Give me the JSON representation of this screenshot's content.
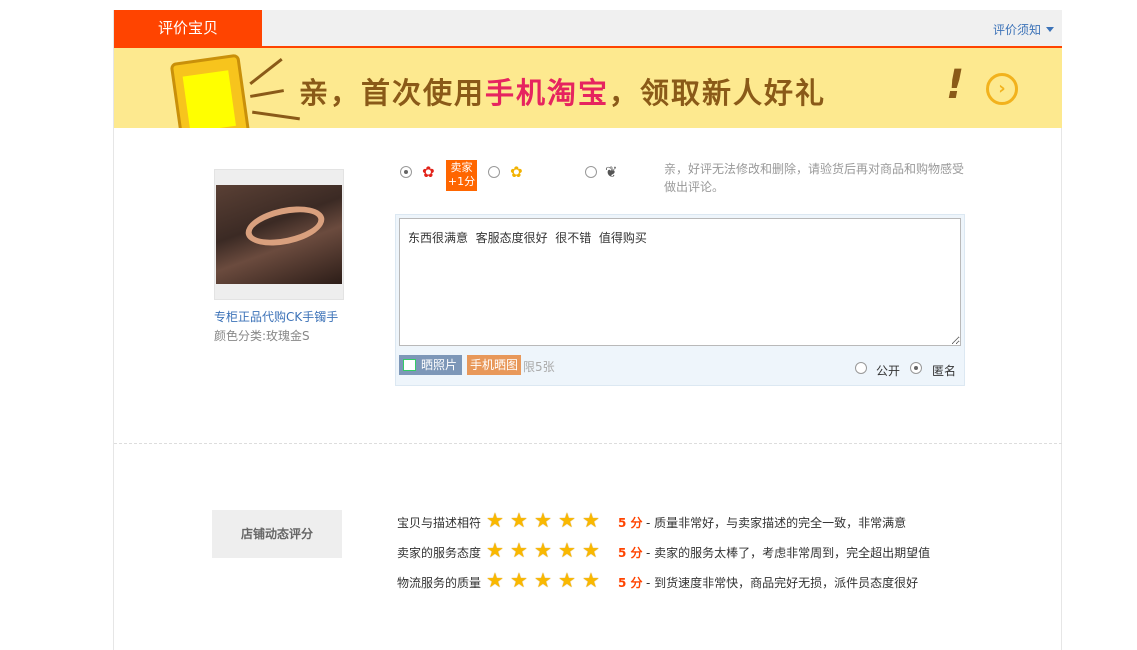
{
  "header": {
    "title": "评价宝贝",
    "guide_label": "评价须知"
  },
  "banner": {
    "text_before": "亲，首次使用",
    "text_highlight": "手机淘宝",
    "text_after": "，领取新人好礼",
    "exclaim": "!",
    "go": "›"
  },
  "product": {
    "name": "专柜正品代购CK手镯手",
    "attr": "颜色分类:玫瑰金S"
  },
  "rating": {
    "options": [
      {
        "icon": "good-flower-icon",
        "selected": true
      },
      {
        "icon": "neutral-flower-icon",
        "selected": false
      },
      {
        "icon": "bad-flower-icon",
        "selected": false
      }
    ],
    "badge_line1": "卖家",
    "badge_line2": "+1分",
    "tip": "亲，好评无法修改和删除，请验货后再对商品和购物感受做出评论。"
  },
  "editor": {
    "content": "东西很满意  客服态度很好  很不错  值得购买",
    "photo_button": "晒照片",
    "mobile_button": "手机晒图",
    "limit": "限5张",
    "visibility": [
      {
        "label": "公开",
        "selected": false
      },
      {
        "label": "匿名",
        "selected": true
      }
    ]
  },
  "dsr": {
    "title": "店铺动态评分",
    "rows": [
      {
        "label": "宝贝与描述相符",
        "stars": 5,
        "score": "5 分",
        "desc": "- 质量非常好，与卖家描述的完全一致，非常满意"
      },
      {
        "label": "卖家的服务态度",
        "stars": 5,
        "score": "5 分",
        "desc": "- 卖家的服务太棒了，考虑非常周到，完全超出期望值"
      },
      {
        "label": "物流服务的质量",
        "stars": 5,
        "score": "5 分",
        "desc": "- 到货速度非常快，商品完好无损，派件员态度很好"
      }
    ]
  },
  "colors": {
    "accent": "#ff4400",
    "link": "#3d73b8",
    "banner_bg": "#fde98f"
  }
}
